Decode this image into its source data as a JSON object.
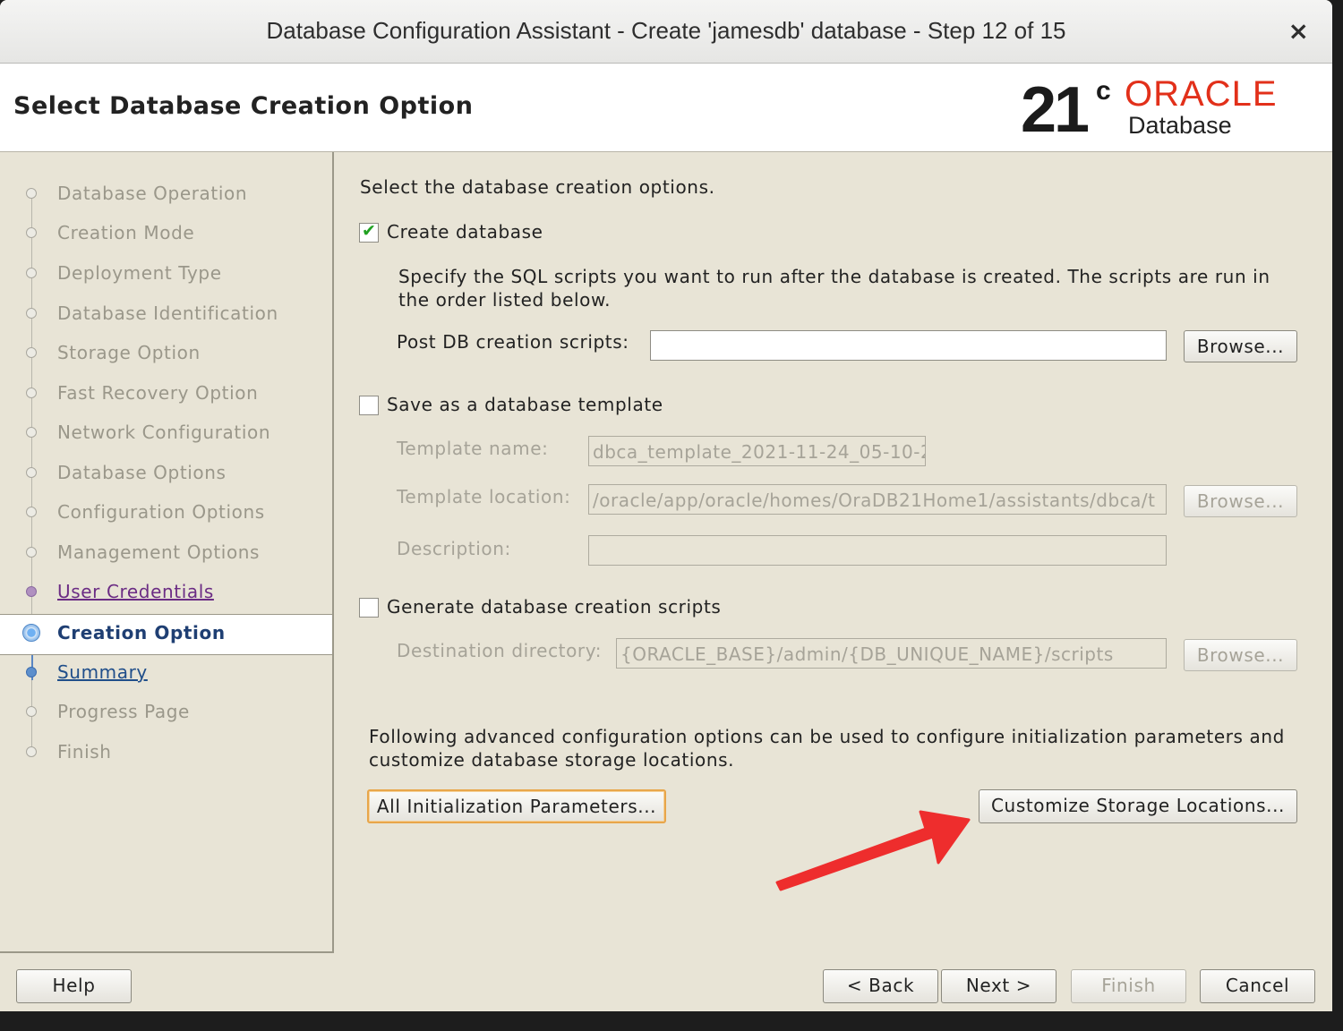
{
  "window": {
    "title": "Database Configuration Assistant - Create 'jamesdb' database - Step 12 of 15",
    "close_glyph": "×"
  },
  "header": {
    "page_title": "Select Database Creation Option",
    "logo": {
      "version": "21",
      "superscript": "c",
      "brand": "ORACLE",
      "product": "Database",
      "brand_color": "#e2301a"
    }
  },
  "sidebar": {
    "steps": [
      {
        "label": "Database Operation",
        "state": "disabled"
      },
      {
        "label": "Creation Mode",
        "state": "disabled"
      },
      {
        "label": "Deployment Type",
        "state": "disabled"
      },
      {
        "label": "Database Identification",
        "state": "disabled"
      },
      {
        "label": "Storage Option",
        "state": "disabled"
      },
      {
        "label": "Fast Recovery Option",
        "state": "disabled"
      },
      {
        "label": "Network Configuration",
        "state": "disabled"
      },
      {
        "label": "Database Options",
        "state": "disabled"
      },
      {
        "label": "Configuration Options",
        "state": "disabled"
      },
      {
        "label": "Management Options",
        "state": "disabled"
      },
      {
        "label": "User Credentials",
        "state": "visited"
      },
      {
        "label": "Creation Option",
        "state": "current"
      },
      {
        "label": "Summary",
        "state": "link"
      },
      {
        "label": "Progress Page",
        "state": "disabled"
      },
      {
        "label": "Finish",
        "state": "disabled"
      }
    ]
  },
  "main": {
    "intro": "Select the database creation options.",
    "create_db": {
      "label": "Create database",
      "checked": true,
      "description_line1": "Specify the SQL scripts you want to run after the database is created. The scripts are run in",
      "description_line2": "the order listed below.",
      "post_scripts_label": "Post DB creation scripts:",
      "post_scripts_value": "",
      "browse_label": "Browse..."
    },
    "save_template": {
      "label": "Save as a database template",
      "checked": false,
      "template_name_label": "Template name:",
      "template_name_value": "dbca_template_2021-11-24_05-10-2",
      "template_location_label": "Template location:",
      "template_location_value": "/oracle/app/oracle/homes/OraDB21Home1/assistants/dbca/t",
      "browse_label": "Browse...",
      "description_label": "Description:",
      "description_value": ""
    },
    "generate_scripts": {
      "label": "Generate database creation scripts",
      "checked": false,
      "destination_label": "Destination directory:",
      "destination_value": "{ORACLE_BASE}/admin/{DB_UNIQUE_NAME}/scripts",
      "browse_label": "Browse..."
    },
    "advanced": {
      "text_line1": "Following advanced configuration options can be used to configure initialization parameters and",
      "text_line2": "customize database storage locations.",
      "init_params_label": "All Initialization Parameters...",
      "storage_label": "Customize Storage Locations..."
    }
  },
  "footer": {
    "help": "Help",
    "back": "< Back",
    "next": "Next >",
    "finish": "Finish",
    "cancel": "Cancel"
  },
  "annotation": {
    "arrow_color": "#ee2d2d"
  }
}
